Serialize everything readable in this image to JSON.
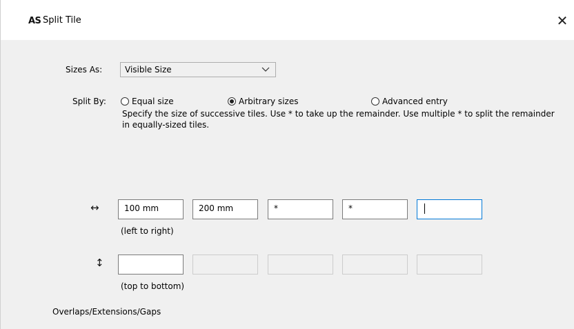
{
  "window": {
    "app_icon_text": "AS",
    "title": "Split Tile",
    "close_glyph": "✕"
  },
  "sizes_as": {
    "label": "Sizes As:",
    "selected": "Visible Size"
  },
  "split_by": {
    "label": "Split By:",
    "options": [
      {
        "label": "Equal size",
        "checked": false
      },
      {
        "label": "Arbitrary sizes",
        "checked": true
      },
      {
        "label": "Advanced entry",
        "checked": false
      }
    ],
    "description": "Specify the size of successive tiles. Use * to take up the remainder. Use multiple * to split the remainder in equally-sized tiles."
  },
  "horizontal": {
    "icon": "↔",
    "fields": [
      "100 mm",
      "200 mm",
      "*",
      "*",
      ""
    ],
    "caption": "(left to right)"
  },
  "vertical": {
    "icon": "↕",
    "fields": [
      "",
      "",
      "",
      "",
      ""
    ],
    "caption": "(top to bottom)"
  },
  "overlaps_label": "Overlaps/Extensions/Gaps"
}
